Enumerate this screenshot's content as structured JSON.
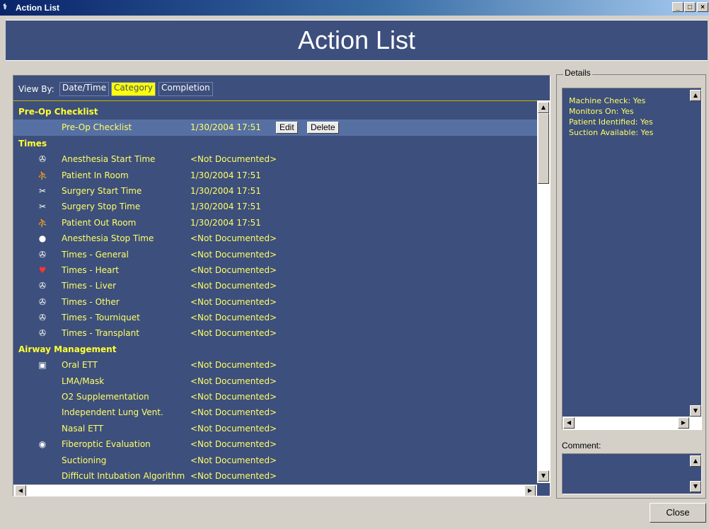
{
  "window": {
    "title": "Action List",
    "min_label": "_",
    "max_label": "□",
    "close_label": "×"
  },
  "banner": {
    "title": "Action List"
  },
  "viewby": {
    "label": "View By:",
    "options": [
      "Date/Time",
      "Category",
      "Completion"
    ],
    "selected": "Category"
  },
  "list": {
    "edit_label": "Edit",
    "delete_label": "Delete",
    "rows": [
      {
        "type": "category",
        "label": "Pre-Op Checklist"
      },
      {
        "type": "item",
        "icon": "",
        "icon_name": "",
        "name": "Pre-Op Checklist",
        "value": "1/30/2004 17:51",
        "selected": true,
        "actions": true
      },
      {
        "type": "category",
        "label": "Times"
      },
      {
        "type": "item",
        "icon": "✇",
        "icon_name": "clock-icon",
        "name": "Anesthesia Start Time",
        "value": "<Not Documented>"
      },
      {
        "type": "item",
        "icon": "⛹",
        "icon_name": "patient-room-icon",
        "name": "Patient In Room",
        "value": "1/30/2004 17:51"
      },
      {
        "type": "item",
        "icon": "✂",
        "icon_name": "scalpel-icon",
        "name": "Surgery Start Time",
        "value": "1/30/2004 17:51"
      },
      {
        "type": "item",
        "icon": "✂",
        "icon_name": "suture-icon",
        "name": "Surgery Stop Time",
        "value": "1/30/2004 17:51"
      },
      {
        "type": "item",
        "icon": "⛹",
        "icon_name": "patient-out-icon",
        "name": "Patient Out Room",
        "value": "1/30/2004 17:51"
      },
      {
        "type": "item",
        "icon": "●",
        "icon_name": "dot-icon",
        "name": "Anesthesia Stop Time",
        "value": "<Not Documented>"
      },
      {
        "type": "item",
        "icon": "✇",
        "icon_name": "clock-icon",
        "name": "Times - General",
        "value": "<Not Documented>"
      },
      {
        "type": "item",
        "icon": "♥",
        "icon_name": "heart-icon",
        "name": "Times - Heart",
        "value": "<Not Documented>"
      },
      {
        "type": "item",
        "icon": "✇",
        "icon_name": "clock-icon",
        "name": "Times - Liver",
        "value": "<Not Documented>"
      },
      {
        "type": "item",
        "icon": "✇",
        "icon_name": "clock-icon",
        "name": "Times - Other",
        "value": "<Not Documented>"
      },
      {
        "type": "item",
        "icon": "✇",
        "icon_name": "clock-icon",
        "name": "Times - Tourniquet",
        "value": "<Not Documented>"
      },
      {
        "type": "item",
        "icon": "✇",
        "icon_name": "clock-icon",
        "name": "Times - Transplant",
        "value": "<Not Documented>"
      },
      {
        "type": "category",
        "label": "Airway Management"
      },
      {
        "type": "item",
        "icon": "▣",
        "icon_name": "ett-tube-icon",
        "name": "Oral ETT",
        "value": "<Not Documented>"
      },
      {
        "type": "item",
        "icon": "",
        "icon_name": "",
        "name": "LMA/Mask",
        "value": "<Not Documented>"
      },
      {
        "type": "item",
        "icon": "",
        "icon_name": "",
        "name": "O2 Supplementation",
        "value": "<Not Documented>"
      },
      {
        "type": "item",
        "icon": "",
        "icon_name": "",
        "name": "Independent Lung Vent.",
        "value": "<Not Documented>"
      },
      {
        "type": "item",
        "icon": "",
        "icon_name": "",
        "name": "Nasal ETT",
        "value": "<Not Documented>"
      },
      {
        "type": "item",
        "icon": "◉",
        "icon_name": "fiberoptic-icon",
        "name": "Fiberoptic Evaluation",
        "value": "<Not Documented>"
      },
      {
        "type": "item",
        "icon": "",
        "icon_name": "",
        "name": "Suctioning",
        "value": "<Not Documented>"
      },
      {
        "type": "item",
        "icon": "",
        "icon_name": "",
        "name": "Difficult Intubation Algorithm",
        "value": "<Not Documented>"
      }
    ]
  },
  "details": {
    "legend": "Details",
    "lines": [
      "Machine Check: Yes",
      "Monitors On: Yes",
      "Patient Identified: Yes",
      "Suction Available: Yes"
    ]
  },
  "comment": {
    "label": "Comment:",
    "value": ""
  },
  "footer": {
    "close_label": "Close"
  },
  "colors": {
    "panel": "#3d4f7c",
    "highlight": "#ffff00",
    "text": "#ffff66",
    "selected_row": "#5670a3"
  }
}
